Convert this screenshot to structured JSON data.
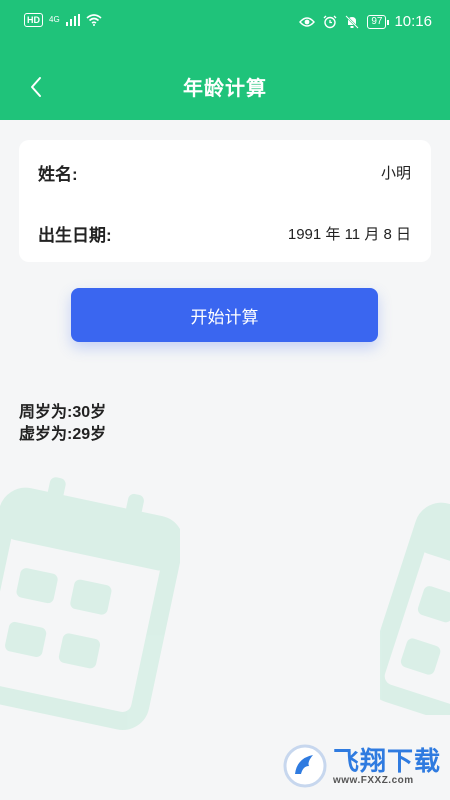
{
  "status_bar": {
    "hd": "HD",
    "network": "4G",
    "battery": "97",
    "time": "10:16"
  },
  "header": {
    "title": "年龄计算"
  },
  "form": {
    "name_label": "姓名:",
    "name_value": "小明",
    "birth_label": "出生日期:",
    "birth_value": "1991 年 11 月 8 日"
  },
  "actions": {
    "calculate_label": "开始计算"
  },
  "results": {
    "full_age": "周岁为:30岁",
    "nominal_age": "虚岁为:29岁"
  },
  "watermark": {
    "brand": "飞翔下载",
    "url": "www.FXXZ.com"
  },
  "colors": {
    "header": "#1fc37a",
    "button": "#3a66f0",
    "background": "#f5f6f7"
  }
}
